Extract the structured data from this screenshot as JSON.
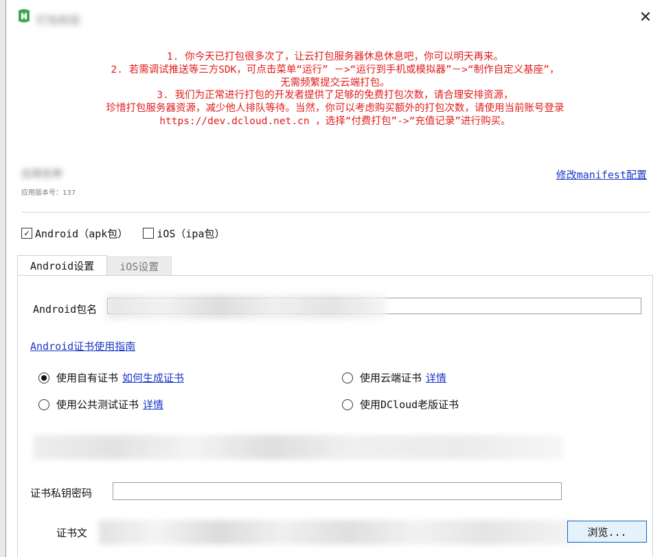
{
  "window": {
    "title": "打包校验",
    "close_glyph": "✕"
  },
  "notice": {
    "lines": [
      "1. 你今天已打包很多次了，让云打包服务器休息休息吧，你可以明天再来。",
      "2. 若需调试推送等三方SDK，可点击菜单“运行” －>“运行到手机或模拟器”－>“制作自定义基座”，",
      "无需频繁提交云端打包。",
      "3. 我们为正常进行打包的开发者提供了足够的免费打包次数，请合理安排资源，",
      "珍惜打包服务器资源，减少他人排队等待。当然，你可以考虑购买额外的打包次数，请使用当前账号登录",
      "https://dev.dcloud.net.cn ，选择“付费打包”->“充值记录”进行购买。"
    ],
    "color": "#e11b1b"
  },
  "app": {
    "name": "应用名称",
    "version_label": "应用版本号：137",
    "manifest_link": "修改manifest配置"
  },
  "platforms": [
    {
      "label": "Android（apk包）",
      "checked": true
    },
    {
      "label": "iOS（ipa包）",
      "checked": false
    }
  ],
  "tabs": [
    {
      "label": "Android设置",
      "active": true
    },
    {
      "label": "iOS设置",
      "active": false
    }
  ],
  "android": {
    "package_label": "Android包名",
    "package_value": "",
    "guide_link": "Android证书使用指南",
    "cert_options": [
      {
        "label": "使用自有证书",
        "link": "如何生成证书",
        "selected": true
      },
      {
        "label": "使用云端证书",
        "link": "详情",
        "selected": false
      },
      {
        "label": "使用公共测试证书",
        "link": "详情",
        "selected": false
      },
      {
        "label": "使用DCloud老版证书",
        "link": "",
        "selected": false
      }
    ],
    "password_label": "证书私钥密码",
    "cert_file_label": "证书文",
    "browse_label": "浏览..."
  },
  "colors": {
    "link": "#1a36c8",
    "accent_border": "#0a64c9"
  },
  "icons": {
    "app": "hbuilder-icon",
    "close": "close-icon"
  }
}
